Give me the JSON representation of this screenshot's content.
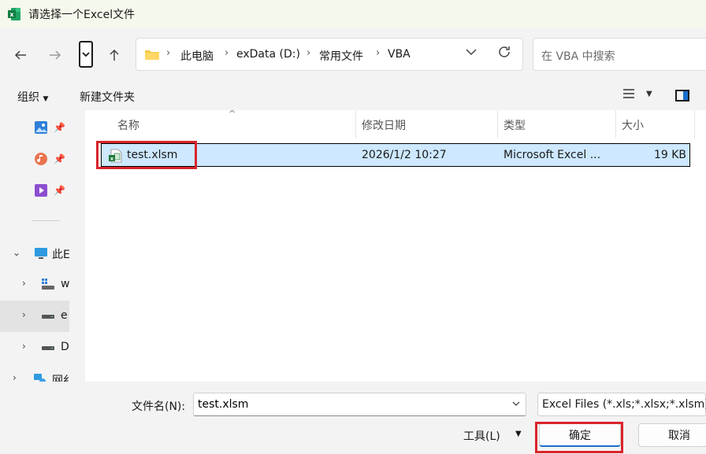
{
  "window": {
    "title": "请选择一个Excel文件"
  },
  "nav": {
    "breadcrumbs": [
      "此电脑",
      "exData (D:)",
      "常用文件",
      "VBA"
    ],
    "search_placeholder": "在 VBA 中搜索"
  },
  "toolbar": {
    "organize_label": "组织",
    "new_folder_label": "新建文件夹"
  },
  "sidebar": {
    "items": [
      {
        "label": "",
        "icon": "pictures-icon",
        "pinned": true
      },
      {
        "label": "",
        "icon": "music-icon",
        "pinned": true
      },
      {
        "label": "",
        "icon": "videos-icon",
        "pinned": true
      },
      {
        "label": "此E",
        "icon": "this-pc-icon",
        "expanded": true
      },
      {
        "label": "w",
        "icon": "windows-drive-icon"
      },
      {
        "label": "e",
        "icon": "drive-icon",
        "selected": true
      },
      {
        "label": "D",
        "icon": "drive-icon"
      },
      {
        "label": "网纟",
        "icon": "network-icon"
      }
    ]
  },
  "file_list": {
    "columns": [
      "名称",
      "修改日期",
      "类型",
      "大小"
    ],
    "rows": [
      {
        "name": "test.xlsm",
        "modified": "2026/1/2 10:27",
        "type": "Microsoft Excel ...",
        "size": "19 KB",
        "selected": true
      }
    ]
  },
  "footer": {
    "filename_label": "文件名(N):",
    "filename_value": "test.xlsm",
    "filter_value": "Excel Files (*.xls;*.xlsx;*.xlsm)",
    "tools_label": "工具(L)",
    "ok_label": "确定",
    "cancel_label": "取消"
  },
  "colors": {
    "selection": "#cde8ff",
    "highlight": "#d9242b",
    "accent": "#1a6fc9",
    "excel_green": "#1d7a3c"
  }
}
